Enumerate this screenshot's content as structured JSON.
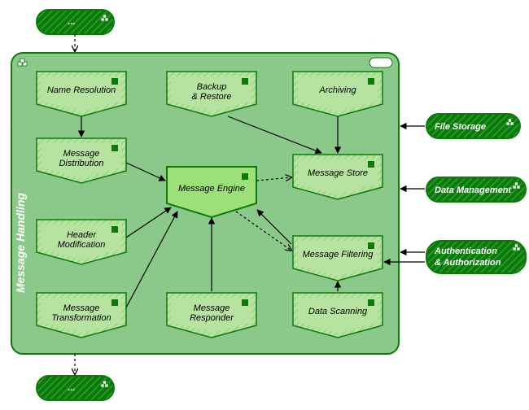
{
  "diagram": {
    "container": {
      "label": "Message Handling"
    },
    "top_ellipsis": "...",
    "bottom_ellipsis": "...",
    "chevrons": {
      "name_resolution": "Name Resolution",
      "backup_restore_l1": "Backup",
      "backup_restore_l2": "& Restore",
      "archiving": "Archiving",
      "message_distribution_l1": "Message",
      "message_distribution_l2": "Distribution",
      "message_engine": "Message Engine",
      "message_store": "Message Store",
      "header_modification_l1": "Header",
      "header_modification_l2": "Modification",
      "message_filtering": "Message Filtering",
      "message_transformation_l1": "Message",
      "message_transformation_l2": "Transformation",
      "message_responder_l1": "Message",
      "message_responder_l2": "Responder",
      "data_scanning": "Data Scanning"
    },
    "externals": {
      "file_storage": "File Storage",
      "data_management": "Data Management",
      "auth_l1": "Authentication",
      "auth_l2": "& Authorization"
    }
  },
  "colors": {
    "container_fill": "#8bc98b",
    "container_stroke": "#0b7a0b",
    "chevron_fill": "#b7e3a1",
    "chevron_stroke": "#0b7a0b",
    "engine_fill": "#9de07a",
    "dark_green": "#0b7a0b",
    "hatch": "#2fa02f"
  }
}
